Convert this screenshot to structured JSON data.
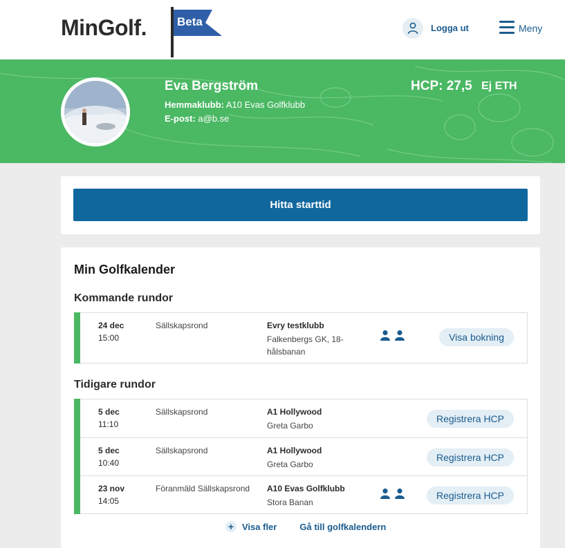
{
  "header": {
    "logo": "MinGolf.",
    "beta": "Beta",
    "logout": "Logga ut",
    "menu": "Meny"
  },
  "profile": {
    "name": "Eva Bergström",
    "home_club_label": "Hemmaklubb:",
    "home_club": "A10 Evas Golfklubb",
    "email_label": "E-post:",
    "email": "a@b.se",
    "hcp": "HCP: 27,5",
    "eth": "Ej ETH"
  },
  "actions": {
    "find_tee_time": "Hitta starttid"
  },
  "calendar": {
    "title": "Min Golfkalender",
    "upcoming_title": "Kommande rundor",
    "upcoming": [
      {
        "date": "24 dec",
        "time": "15:00",
        "type": "Sällskapsrond",
        "club": "Evry testklubb",
        "course": "Falkenbergs GK, 18-hålsbanan",
        "players": 2,
        "action": "Visa bokning"
      }
    ],
    "past_title": "Tidigare rundor",
    "past": [
      {
        "date": "5 dec",
        "time": "11:10",
        "type": "Sällskapsrond",
        "club": "A1 Hollywood",
        "course": "Greta Garbo",
        "players": 0,
        "action": "Registrera HCP"
      },
      {
        "date": "5 dec",
        "time": "10:40",
        "type": "Sällskapsrond",
        "club": "A1 Hollywood",
        "course": "Greta Garbo",
        "players": 0,
        "action": "Registrera HCP"
      },
      {
        "date": "23 nov",
        "time": "14:05",
        "type": "Föranmäld Sällskapsrond",
        "club": "A10 Evas Golfklubb",
        "course": "Stora Banan",
        "players": 2,
        "action": "Registrera HCP"
      }
    ],
    "show_more": "Visa fler",
    "go_to_calendar": "Gå till golfkalendern"
  },
  "colors": {
    "green": "#4bb864",
    "blue": "#10679e",
    "link": "#1b5c8f",
    "pill": "#e3eef5"
  }
}
